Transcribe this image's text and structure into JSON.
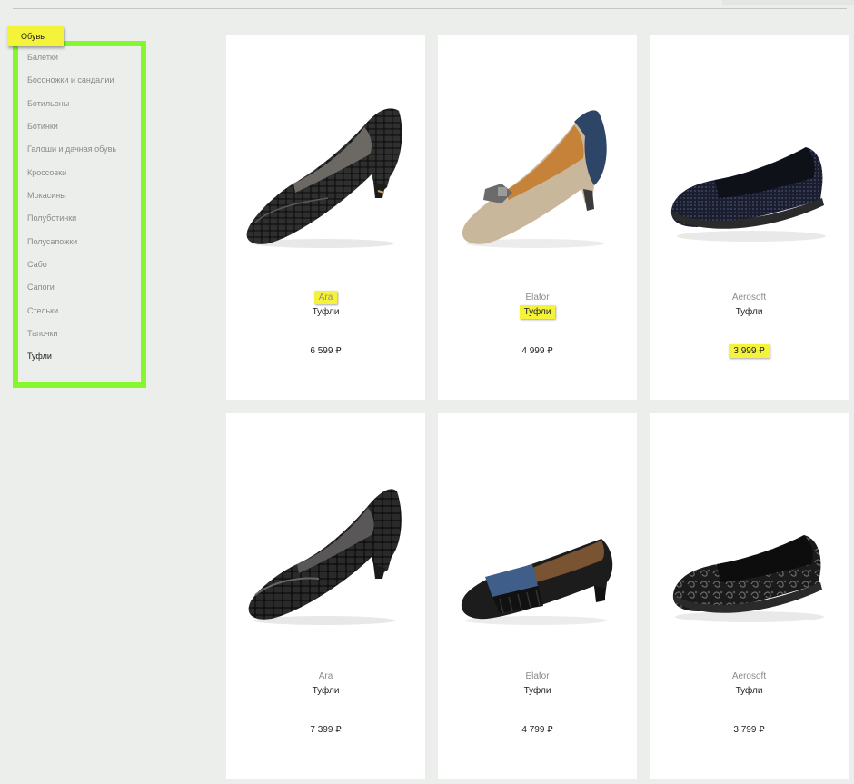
{
  "category": {
    "title": "Обувь",
    "items": [
      {
        "label": "Балетки"
      },
      {
        "label": "Босоножки и сандалии"
      },
      {
        "label": "Ботильоны"
      },
      {
        "label": "Ботинки"
      },
      {
        "label": "Галоши и дачная обувь"
      },
      {
        "label": "Кроссовки"
      },
      {
        "label": "Мокасины"
      },
      {
        "label": "Полуботинки"
      },
      {
        "label": "Полусапожки"
      },
      {
        "label": "Сабо"
      },
      {
        "label": "Сапоги"
      },
      {
        "label": "Стельки"
      },
      {
        "label": "Тапочки"
      },
      {
        "label": "Туфли"
      }
    ],
    "active_item": "Туфли"
  },
  "products": [
    {
      "brand": "Ara",
      "type": "Туфли",
      "price": "6 599 ₽",
      "image": "black-croc-pump-image"
    },
    {
      "brand": "Elafor",
      "type": "Туфли",
      "price": "4 999 ₽",
      "image": "beige-navy-bow-pump-image"
    },
    {
      "brand": "Aerosoft",
      "type": "Туфли",
      "price": "3 999 ₽",
      "image": "navy-textured-slip-on-image"
    },
    {
      "brand": "Ara",
      "type": "Туфли",
      "price": "7 399 ₽",
      "image": "black-patent-pump-image"
    },
    {
      "brand": "Elafor",
      "type": "Туфли",
      "price": "4 799 ₽",
      "image": "black-fringe-loafer-image"
    },
    {
      "brand": "Aerosoft",
      "type": "Туфли",
      "price": "3 799 ₽",
      "image": "floral-black-slip-on-image"
    }
  ],
  "colors": {
    "highlight": "#f5f23a",
    "sidebar_frame": "#84f72e",
    "page_bg": "#eceeec",
    "card_bg": "#ffffff"
  }
}
